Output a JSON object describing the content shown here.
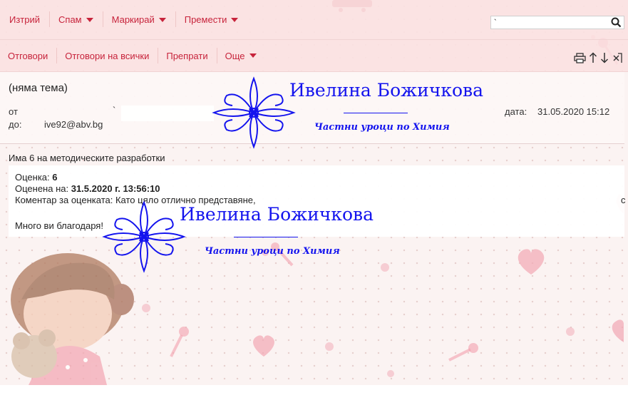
{
  "toolbar_top": {
    "delete": "Изтрий",
    "spam": "Спам",
    "mark": "Маркирай",
    "move": "Премести"
  },
  "search": {
    "value": "`"
  },
  "toolbar_msg": {
    "reply": "Отговори",
    "reply_all": "Отговори на всички",
    "forward": "Препрати",
    "more": "Още"
  },
  "message": {
    "subject": "(няма тема)",
    "from_label": "от",
    "from_value": "`",
    "to_label": "до:",
    "to_value": "ive92@abv.bg",
    "date_label": "дата:",
    "date_value": "31.05.2020 15:12",
    "intro": "Има 6 на методическите разработки"
  },
  "grade": {
    "grade_label": "Оценка: ",
    "grade_value": "6",
    "graded_label": "Оценена на: ",
    "graded_value": "31.5.2020 г. 13:56:10",
    "comment_label": "Коментар за оценката: ",
    "comment_value": "Като цяло отлично представяне,",
    "comment_tail": "с",
    "thanks": "Много ви благодаря!"
  },
  "watermark": {
    "name": "Ивелина Божичкова",
    "subtitle": "Частни уроци по Химия"
  },
  "colors": {
    "accent": "#c7233b",
    "watermark": "#1414ee",
    "toolbar_bg": "#fbe2e2"
  },
  "icons": [
    "caret-down-icon",
    "search-icon",
    "print-icon",
    "arrow-up-icon",
    "arrow-down-icon",
    "close-icon",
    "ornament-icon"
  ]
}
